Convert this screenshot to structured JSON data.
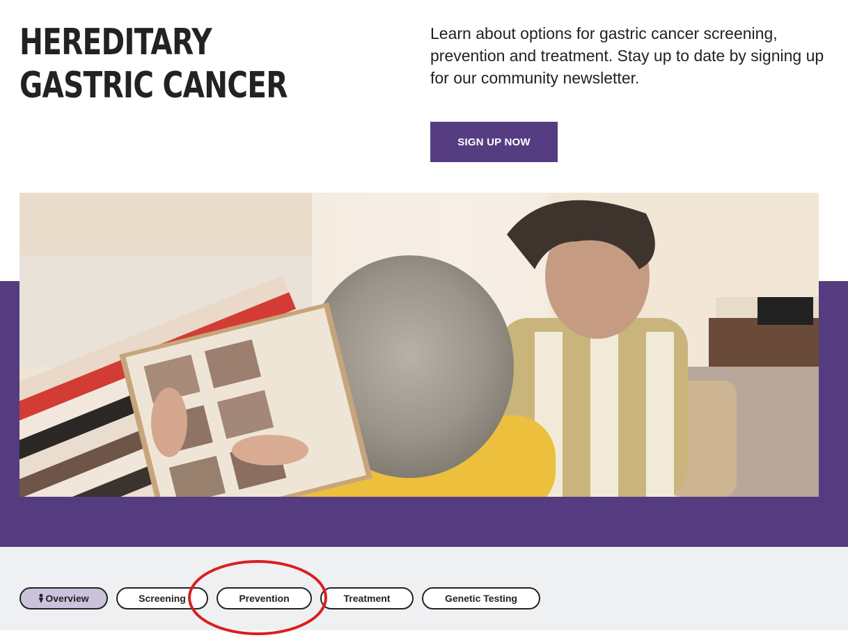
{
  "header": {
    "title": "HEREDITARY GASTRIC CANCER",
    "intro": "Learn about options for gastric cancer screening, prevention and treatment. Stay up to date by signing up for our community newsletter.",
    "signup_label": "SIGN UP NOW"
  },
  "hero": {
    "image": "photo-elderly-woman-and-man-looking-at-photo-album"
  },
  "tabs": [
    {
      "label": "Overview",
      "active": true,
      "icon": "location-pin-icon"
    },
    {
      "label": "Screening",
      "active": false
    },
    {
      "label": "Prevention",
      "active": false,
      "annotated": true
    },
    {
      "label": "Treatment",
      "active": false
    },
    {
      "label": "Genetic Testing",
      "active": false
    }
  ],
  "colors": {
    "brand_purple": "#553c80",
    "button_purple": "#563d82",
    "active_tab": "#cbc2dc",
    "tab_bar_bg": "#eff0f2",
    "annotation_red": "#d91f1f"
  }
}
